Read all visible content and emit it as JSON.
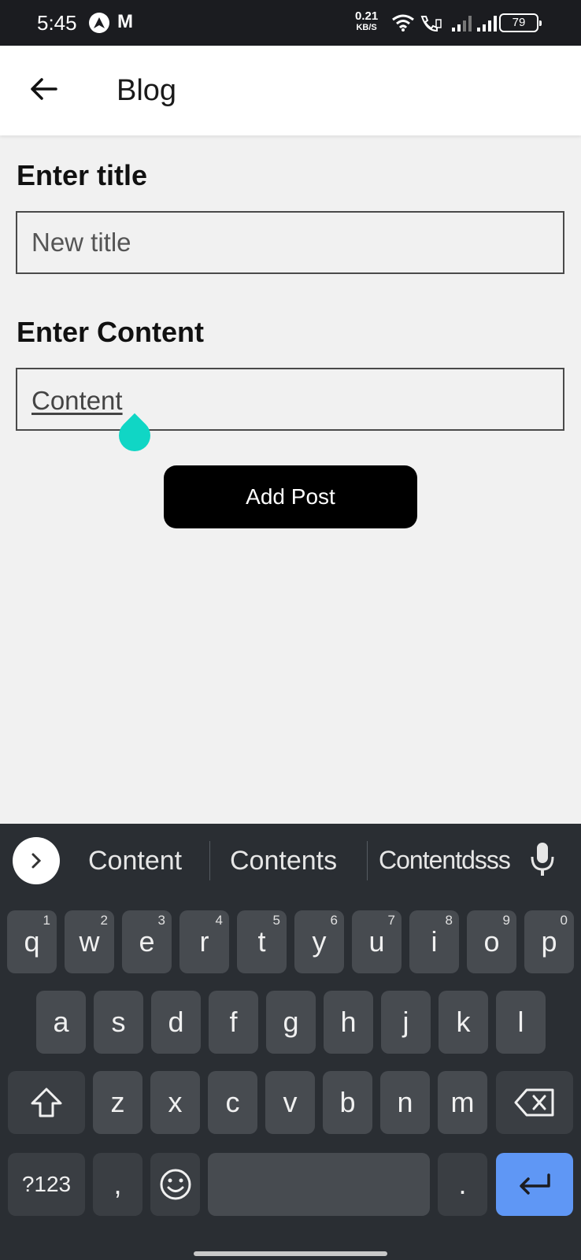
{
  "status_bar": {
    "time": "5:45",
    "net_speed_value": "0.21",
    "net_speed_unit": "KB/S",
    "battery": "79",
    "app_badge": "M"
  },
  "app_bar": {
    "title": "Blog"
  },
  "form": {
    "title_label": "Enter title",
    "title_placeholder": "New title",
    "content_label": "Enter Content",
    "content_value": "Content",
    "submit_label": "Add Post"
  },
  "keyboard": {
    "suggestions": [
      "Content",
      "Contents",
      "Contentdsss"
    ],
    "row1": [
      {
        "k": "q",
        "h": "1"
      },
      {
        "k": "w",
        "h": "2"
      },
      {
        "k": "e",
        "h": "3"
      },
      {
        "k": "r",
        "h": "4"
      },
      {
        "k": "t",
        "h": "5"
      },
      {
        "k": "y",
        "h": "6"
      },
      {
        "k": "u",
        "h": "7"
      },
      {
        "k": "i",
        "h": "8"
      },
      {
        "k": "o",
        "h": "9"
      },
      {
        "k": "p",
        "h": "0"
      }
    ],
    "row2": [
      "a",
      "s",
      "d",
      "f",
      "g",
      "h",
      "j",
      "k",
      "l"
    ],
    "row3": [
      "z",
      "x",
      "c",
      "v",
      "b",
      "n",
      "m"
    ],
    "symbols_label": "?123",
    "comma": ",",
    "period": "."
  },
  "colors": {
    "accent_handle": "#10d6c5",
    "enter_key": "#5f97f5",
    "button_bg": "#000000"
  }
}
